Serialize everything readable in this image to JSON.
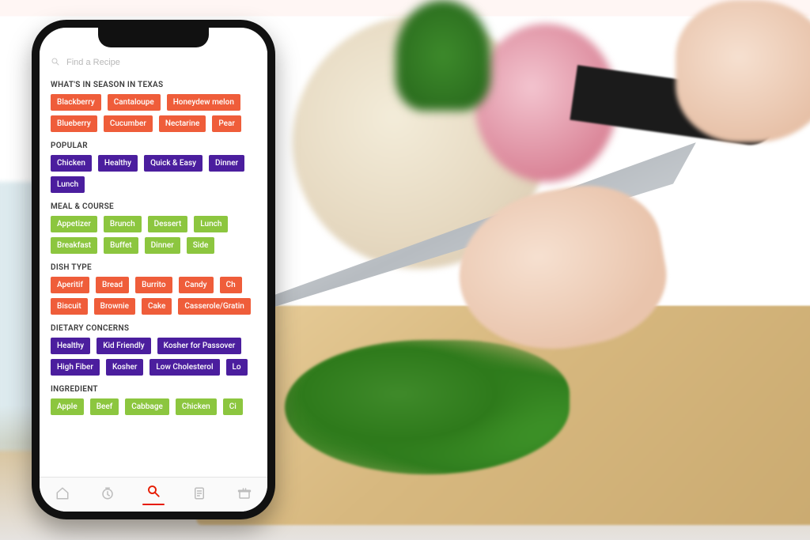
{
  "colors": {
    "red": "#ef5d3a",
    "purple": "#4b1e9e",
    "green": "#8cc63f",
    "accent": "#e61b00"
  },
  "search": {
    "placeholder": "Find a Recipe"
  },
  "sections": [
    {
      "title": "WHAT'S IN SEASON IN TEXAS",
      "color": "red",
      "tags": [
        "Blackberry",
        "Cantaloupe",
        "Honeydew melon",
        "Blueberry",
        "Cucumber",
        "Nectarine",
        "Pear"
      ]
    },
    {
      "title": "POPULAR",
      "color": "purple",
      "tags": [
        "Chicken",
        "Healthy",
        "Quick & Easy",
        "Dinner",
        "Lunch"
      ]
    },
    {
      "title": "MEAL & COURSE",
      "color": "green",
      "tags": [
        "Appetizer",
        "Brunch",
        "Dessert",
        "Lunch",
        "Breakfast",
        "Buffet",
        "Dinner",
        "Side"
      ]
    },
    {
      "title": "DISH TYPE",
      "color": "red",
      "tags": [
        "Aperitif",
        "Bread",
        "Burrito",
        "Candy",
        "Ch",
        "Biscuit",
        "Brownie",
        "Cake",
        "Casserole/Gratin"
      ]
    },
    {
      "title": "DIETARY CONCERNS",
      "color": "purple",
      "tags": [
        "Healthy",
        "Kid Friendly",
        "Kosher for Passover",
        "High Fiber",
        "Kosher",
        "Low Cholesterol",
        "Lo"
      ]
    },
    {
      "title": "INGREDIENT",
      "color": "green",
      "tags": [
        "Apple",
        "Beef",
        "Cabbage",
        "Chicken",
        "Ci"
      ]
    }
  ],
  "tabbar": {
    "items": [
      {
        "name": "home",
        "icon": "home-icon",
        "active": false
      },
      {
        "name": "timer",
        "icon": "clock-icon",
        "active": false
      },
      {
        "name": "search",
        "icon": "search-icon",
        "active": true
      },
      {
        "name": "list",
        "icon": "list-icon",
        "active": false
      },
      {
        "name": "basket",
        "icon": "basket-icon",
        "active": false
      }
    ]
  }
}
